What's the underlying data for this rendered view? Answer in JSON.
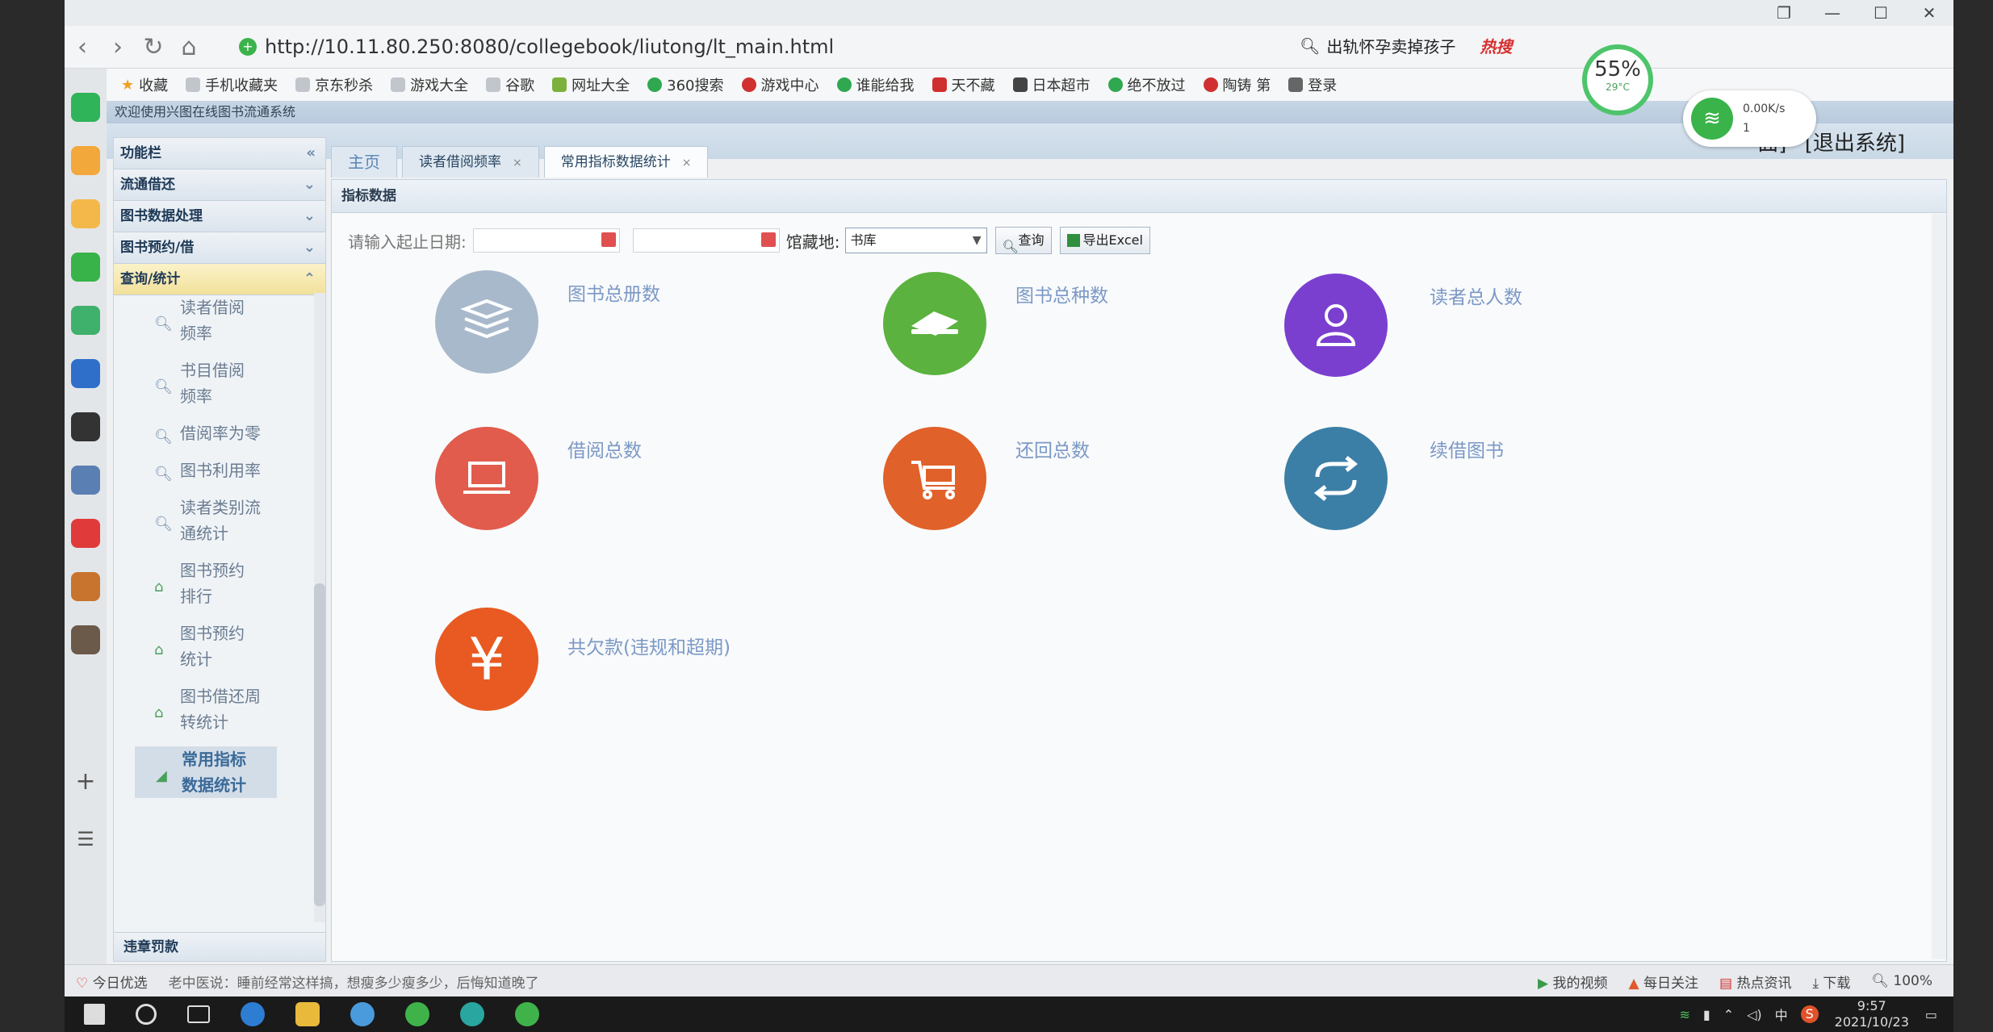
{
  "browser": {
    "url": "http://10.11.80.250:8080/collegebook/liutong/lt_main.html",
    "search_text": "出轨怀孕卖掉孩子",
    "hot_label": "热搜",
    "bookmarks": [
      "收藏",
      "手机收藏夹",
      "京东秒杀",
      "游戏大全",
      "谷歌",
      "网址大全",
      "360搜索",
      "游戏中心",
      "谁能给我",
      "天不藏",
      "日本超市",
      "绝不放过",
      "陶铸 第",
      "登录"
    ]
  },
  "overlays": {
    "gauge_pct": "55%",
    "gauge_temp": "29°C",
    "net_speed": "0.00K/s",
    "net_count": "1"
  },
  "app": {
    "welcome": "欢迎使用兴图在线图书流通系统",
    "logout": "[退出系统]",
    "logout_partial": "面]"
  },
  "sidebar": {
    "title": "功能栏",
    "sections": [
      "流通借还",
      "图书数据处理",
      "图书预约/借",
      "查询/统计"
    ],
    "items": [
      {
        "label": "读者借阅频率",
        "icon": "magnifier-icon"
      },
      {
        "label": "书目借阅频率",
        "icon": "magnifier-icon"
      },
      {
        "label": "借阅率为零",
        "icon": "magnifier-icon"
      },
      {
        "label": "图书利用率",
        "icon": "magnifier-icon"
      },
      {
        "label": "读者类别流通统计",
        "icon": "magnifier-icon"
      },
      {
        "label": "图书预约排行",
        "icon": "home-icon"
      },
      {
        "label": "图书预约统计",
        "icon": "home-icon"
      },
      {
        "label": "图书借还周转统计",
        "icon": "home-icon"
      },
      {
        "label": "常用指标数据统计",
        "icon": "chart-icon"
      }
    ],
    "footer": "违章罚款"
  },
  "tabs": [
    {
      "label": "主页",
      "closable": false
    },
    {
      "label": "读者借阅频率",
      "closable": true
    },
    {
      "label": "常用指标数据统计",
      "closable": true
    }
  ],
  "panel": {
    "title": "指标数据",
    "date_label": "请输入起止日期:",
    "location_label": "馆藏地:",
    "location_value": "书库",
    "query_btn": "查询",
    "export_btn": "导出Excel"
  },
  "stats": [
    {
      "label": "图书总册数",
      "color": "#a9b9cc",
      "icon": "books-stack-icon"
    },
    {
      "label": "图书总种数",
      "color": "#5bb23f",
      "icon": "book-hand-icon"
    },
    {
      "label": "读者总人数",
      "color": "#7a3fcf",
      "icon": "user-icon"
    },
    {
      "label": "借阅总数",
      "color": "#e15c4c",
      "icon": "laptop-icon"
    },
    {
      "label": "还回总数",
      "color": "#e0612a",
      "icon": "cart-icon"
    },
    {
      "label": "续借图书",
      "color": "#3b7fa6",
      "icon": "refresh-icon"
    },
    {
      "label": "共欠款(违规和超期)",
      "color": "#e85a22",
      "icon": "yen-icon"
    }
  ],
  "statusbar": {
    "today": "今日优选",
    "news": "老中医说：睡前经常这样搞，想瘦多少瘦多少，后悔知道晚了",
    "my_video": "我的视频",
    "follow": "每日关注",
    "hot_news": "热点资讯",
    "download": "下载",
    "zoom": "100%"
  },
  "taskbar": {
    "time": "9:57",
    "date": "2021/10/23",
    "ime": "中"
  }
}
